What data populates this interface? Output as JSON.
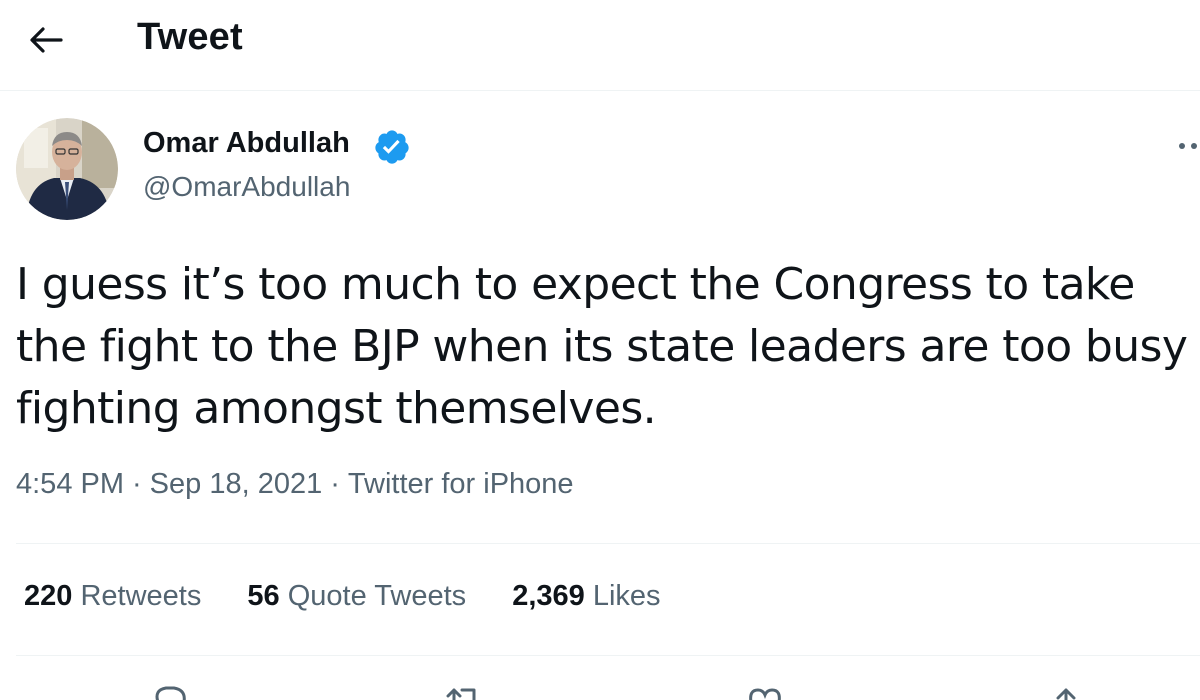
{
  "header": {
    "title": "Tweet",
    "back_icon": "arrow-left-icon"
  },
  "author": {
    "display_name": "Omar Abdullah",
    "handle": "@OmarAbdullah",
    "verified_icon": "verified-badge-icon",
    "verified_color": "#1d9bf0"
  },
  "tweet": {
    "text_lines": [
      "I guess it’s too much to expect the Congress to take",
      "the fight to the BJP when its state leaders are too busy",
      "fighting amongst themselves."
    ],
    "time": "4:54 PM",
    "date": "Sep 18, 2021",
    "separator": "·",
    "source": "Twitter for iPhone"
  },
  "stats": {
    "retweets_count": "220",
    "retweets_label": "Retweets",
    "quotes_count": "56",
    "quotes_label": "Quote Tweets",
    "likes_count": "2,369",
    "likes_label": "Likes"
  },
  "actions": [
    "reply-icon",
    "retweet-icon",
    "like-icon",
    "share-icon"
  ],
  "colors": {
    "text": "#0f1419",
    "secondary": "#536471",
    "divider": "#eff3f4"
  }
}
